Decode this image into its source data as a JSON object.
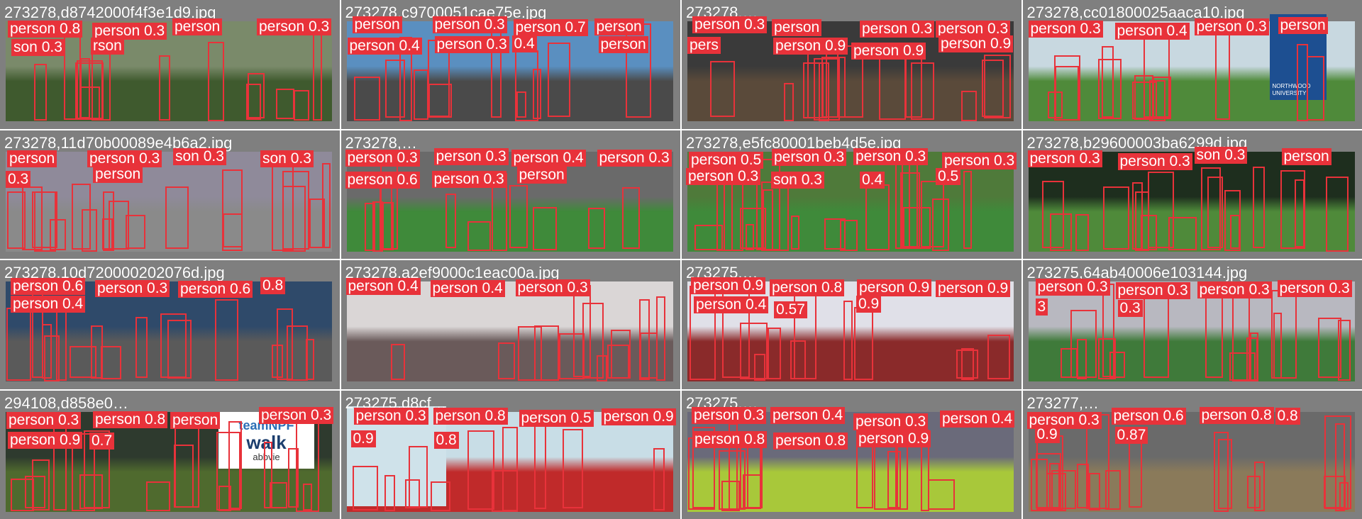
{
  "colors": {
    "background": "#7f7f7f",
    "box": "#e8323a",
    "label_text": "#ffffff"
  },
  "tiles": [
    {
      "name": "273278,d8742000f4f3e1d9.jpg",
      "labels": [
        "person 0.8",
        "person 0.3",
        "person",
        "person 0.3",
        "son 0.3",
        "rson"
      ],
      "scene": {
        "sky": "#7a8a6a",
        "ground": "#3f5a2e"
      }
    },
    {
      "name": "273278,c9700051cae75e.jpg",
      "labels": [
        "person",
        "person 0.3",
        "person 0.7",
        "person",
        "person 0.4",
        "person 0.3",
        "0.4",
        "person"
      ],
      "scene": {
        "sky": "#5a8fc0",
        "ground": "#4a4a4a"
      }
    },
    {
      "name": "273278,…",
      "labels": [
        "person 0.3",
        "person",
        "person 0.3",
        "person 0.3",
        "pers",
        "person 0.9",
        "person 0.9",
        "person 0.9"
      ],
      "scene": {
        "sky": "#3a3a3a",
        "ground": "#5a4a3a"
      }
    },
    {
      "name": "273278,cc01800025aaca10.jpg",
      "labels": [
        "person 0.3",
        "person 0.4",
        "person 0.3",
        "person"
      ],
      "scene": {
        "sky": "#c8d8e0",
        "ground": "#4f8a3a"
      }
    },
    {
      "name": "273278,11d70b00089e4b6a2.jpg",
      "labels": [
        "person",
        "person 0.3",
        "son 0.3",
        "son 0.3",
        "0.3",
        "person"
      ],
      "scene": {
        "sky": "#8f8a9a",
        "ground": "#8a8a8a"
      }
    },
    {
      "name": "273278,…",
      "labels": [
        "person 0.3",
        "person 0.3",
        "person 0.4",
        "person 0.3",
        "person 0.6",
        "person 0.3",
        "person"
      ],
      "scene": {
        "sky": "#6a6a6a",
        "ground": "#3f8a3a"
      }
    },
    {
      "name": "273278,e5fc80001beb4d5e.jpg",
      "labels": [
        "person 0.5",
        "person 0.3",
        "person 0.3",
        "person 0.3",
        "person 0.3",
        "son 0.3",
        "0.4",
        "0.5"
      ],
      "scene": {
        "sky": "#4f7a3a",
        "ground": "#3f8a3a"
      }
    },
    {
      "name": "273278,b29600003ba6299d.jpg",
      "labels": [
        "person 0.3",
        "person 0.3",
        "son 0.3",
        "person"
      ],
      "scene": {
        "sky": "#1e2e1e",
        "ground": "#4f8a3a"
      }
    },
    {
      "name": "273278,10d720000202076d.jpg",
      "labels": [
        "person 0.6",
        "person 0.3",
        "person 0.6",
        "0.8",
        "person 0.4"
      ],
      "scene": {
        "sky": "#2f4a6a",
        "ground": "#5a5a5a"
      }
    },
    {
      "name": "273278,a2ef9000c1eac00a.jpg",
      "labels": [
        "person 0.4",
        "person 0.4",
        "person 0.3"
      ],
      "scene": {
        "sky": "#dad6d6",
        "ground": "#6a5a5a"
      }
    },
    {
      "name": "273275,…",
      "labels": [
        "person 0.9",
        "person 0.8",
        "person 0.9",
        "person 0.9",
        "person 0.4",
        "0.57",
        "0.9"
      ],
      "scene": {
        "sky": "#e0e0e8",
        "ground": "#8a2a2a"
      }
    },
    {
      "name": "273275,64ab40006e103144.jpg",
      "labels": [
        "person 0.3",
        "person 0.3",
        "person 0.3",
        "person 0.3",
        "3",
        "0.3"
      ],
      "scene": {
        "sky": "#b8b8c0",
        "ground": "#3f7a3a"
      }
    },
    {
      "name": "294108,d858e0…",
      "labels": [
        "person 0.3",
        "person 0.8",
        "person",
        "person 0.3",
        "person 0.9",
        "0.7"
      ],
      "scene": {
        "sky": "#2e3a2e",
        "ground": "#4f6a2e"
      }
    },
    {
      "name": "273275,d8cf…",
      "labels": [
        "person 0.3",
        "person 0.8",
        "person 0.5",
        "person 0.9",
        "0.9",
        "0.8"
      ],
      "scene": {
        "sky": "#c8dde6",
        "ground": "#c02a2a"
      }
    },
    {
      "name": "273275,…",
      "labels": [
        "person 0.3",
        "person 0.4",
        "person 0.3",
        "person 0.4",
        "person 0.8",
        "person 0.8",
        "person 0.9"
      ],
      "scene": {
        "sky": "#6a6a7a",
        "ground": "#a8c83a"
      }
    },
    {
      "name": "273277,…",
      "labels": [
        "person 0.3",
        "person 0.6",
        "person 0.8",
        "0.8",
        "0.9",
        "0.87"
      ],
      "scene": {
        "sky": "#6a6a6a",
        "ground": "#8a7a5a"
      }
    }
  ],
  "logos": {
    "team_npf": {
      "line1": "teamNPF",
      "line2": "walk",
      "line3": "abbvie"
    },
    "sign": {
      "line1": "NORTHWOOD",
      "line2": "UNIVERSITY"
    }
  }
}
